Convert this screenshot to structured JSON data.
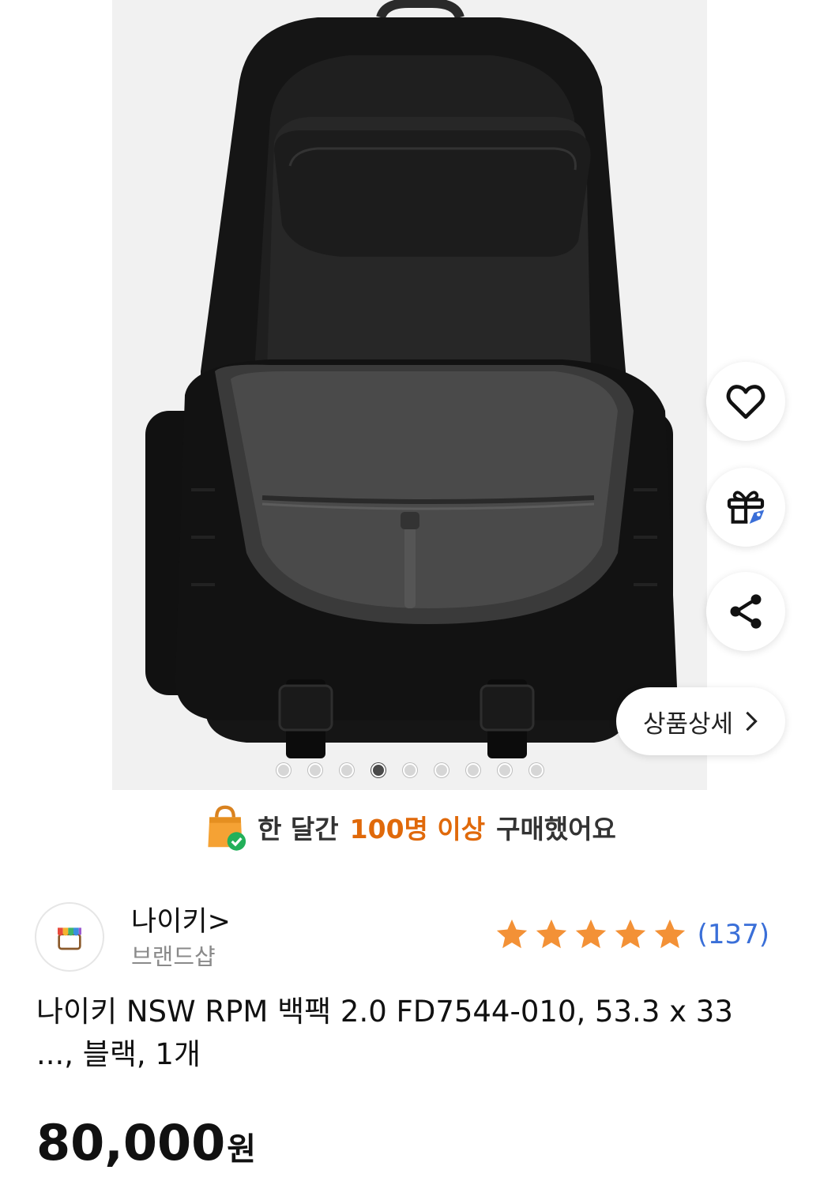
{
  "gallery": {
    "image_alt": "Nike NSW RPM backpack open view",
    "dot_count": 9,
    "active_dot": 4
  },
  "actions": {
    "wishlist_icon": "heart-icon",
    "gift_icon": "gift-icon",
    "share_icon": "share-icon",
    "detail_label": "상품상세",
    "detail_chevron": "›"
  },
  "social_proof": {
    "prefix": "한 달간",
    "highlight": "100명 이상",
    "suffix": "구매했어요",
    "icon": "shopping-bag-check-icon",
    "highlight_color": "#e0690a"
  },
  "brand": {
    "name": "나이키",
    "arrow": ">",
    "subtitle": "브랜드샵"
  },
  "rating": {
    "stars": 5,
    "review_count": "(137)",
    "star_color": "#f39136",
    "count_color": "#3a6fd8"
  },
  "product": {
    "title": "나이키 NSW RPM 백팩 2.0 FD7544-010, 53.3 x 33 ..., 블랙, 1개",
    "price": "80,000",
    "currency": "원"
  }
}
